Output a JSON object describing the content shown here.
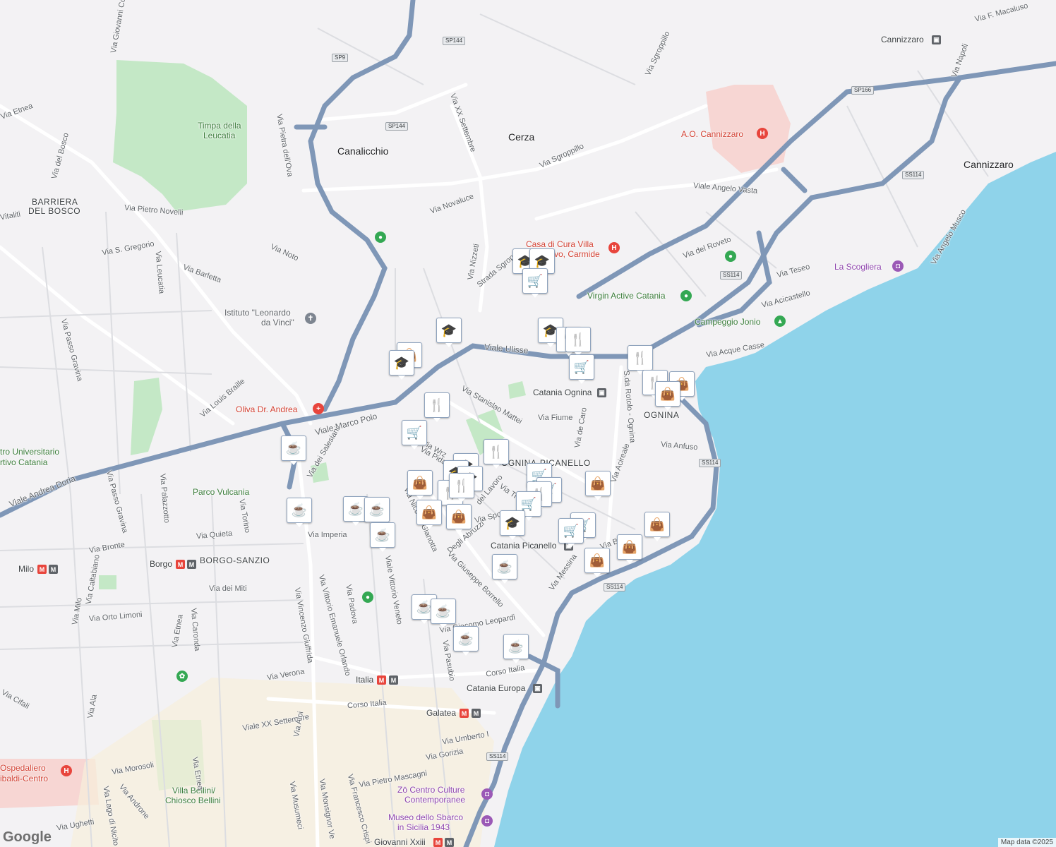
{
  "colors": {
    "background": "#f3f2f4",
    "sea": "#8fd3ea",
    "park": "#c4e8c6",
    "hospital": "#f3c1bd",
    "highway": "#7f97b7",
    "major_road": "#ffffff",
    "marker_icon": "#1a3458"
  },
  "labels": {
    "canalicchio": "Canalicchio",
    "cerza": "Cerza",
    "cannizzaro1": "Cannizzaro",
    "cannizzaro2": "Cannizzaro",
    "barriera1": "BARRIERA",
    "barriera2": "DEL BOSCO",
    "timpa1": "Timpa della",
    "timpa2": "Leucatia",
    "ognina": "OGNINA",
    "ognina_picanello": "OGNINA-PICANELLO",
    "borgo_sanzio": "BORGO-SANZIO",
    "parco_vulcania": "Parco Vulcania",
    "centro_univ1": "tro Universitario",
    "centro_univ2": "rtivo Catania",
    "istituto1": "Istituto \"Leonardo",
    "istituto2": "da Vinci\"",
    "oliva": "Oliva Dr. Andrea",
    "casa_cura1": "Casa di Cura Villa",
    "casa_cura2": "vo, Carmide",
    "ao_cannizzaro": "A.O. Cannizzaro",
    "virgin": "Virgin Active Catania",
    "scogliera": "La Scogliera",
    "campeggio": "Campeggio Jonio",
    "catania_ognina": "Catania Ognina",
    "catania_picanello": "Catania Picanello",
    "catania_europa": "Catania Europa",
    "ospedaliero1": "Ospedaliero",
    "ospedaliero2": "ibaldi-Centro",
    "villa_bellini1": "Villa Bellini/",
    "villa_bellini2": "Chiosco Bellini",
    "zo1": "Zō Centro Culture",
    "zo2": "Contemporanee",
    "museo1": "Museo dello Sbarco",
    "museo2": "in Sicilia 1943",
    "milo": "Milo",
    "borgo": "Borgo",
    "italia": "Italia",
    "galatea": "Galatea",
    "giovanni": "Giovanni Xxiii",
    "via_etnea_top": "Via Etnea",
    "via_del_bosco": "Via del Bosco",
    "via_giovanni": "Via Giovanni Co",
    "via_pietra": "Via Pietra dell'Ova",
    "via_xx_settembre_top": "Via XX Settembre",
    "via_sgroppillo1": "Via Sgroppillo",
    "via_sgroppillo2": "Via Sgroppillo",
    "via_novaluce": "Via Novaluce",
    "via_nizzeti": "Via Nizzeti",
    "strada_sgrop": "Strada Sgrop",
    "via_pietro_novelli": "Via Pietro Novelli",
    "via_vitaliti": "Vitaliti",
    "via_s_gregorio": "Via S. Gregorio",
    "via_noto": "Via Noto",
    "via_barletta": "Via Barletta",
    "via_leucatia": "Via Leucatia",
    "via_passo_gravina1": "Via Passo Gravina",
    "via_passo_gravina2": "Via Passo Gravina",
    "via_louis_braille": "Via Louis Braille",
    "viale_marco_polo": "Viale Marco Polo",
    "viale_andrea_doria": "Viale Andrea Doria",
    "viale_ulisse": "Viale Ulisse",
    "via_stanislao": "Via Stanislao Mattei",
    "via_fiume": "Via Fiume",
    "via_de_caro": "Via de Caro",
    "via_rotolo": "S.da Rotolo - Ognina",
    "via_acireale": "Via Acireale",
    "via_anfuso": "Via Anfuso",
    "via_del_roveto": "Via del Roveto",
    "viale_angelo_vasta": "Viale Angelo Vasta",
    "via_teseo": "Via Teseo",
    "via_acicastello": "Via Acicastello",
    "via_acque_casse": "Via Acque Casse",
    "via_angelo_musco": "Via Angelo Musco",
    "via_napoli": "Via Napoli",
    "via_f_macaluso": "Via F. Macaluso",
    "via_dei_salesiani": "Via dei Salesiani",
    "via_palazzotto": "Via Palazzotto",
    "via_torino": "Via Torino",
    "via_quieta": "Via Quieta",
    "via_imperia": "Via Imperia",
    "via_bronte": "Via Bronte",
    "via_caltabiano": "Via Caltabiano",
    "via_milo": "Via Milo",
    "via_orto_limoni": "Via Orto Limoni",
    "via_dei_miti": "Via dei Miti",
    "via_etnea": "Via Etnea",
    "via_caronda": "Via Caronda",
    "via_nicolo": "Via Niccolò Gianotta",
    "via_abruzzi": "Degli Abruzzi",
    "via_giuseppe_borrello": "Via Giuseppe Borrello",
    "via_spoto": "Via Spoto",
    "via_messina": "Via Messina",
    "via_leopardi": "Via Giacomo Leopardi",
    "via_padova": "Via Padova",
    "viale_vittorio_veneto": "Viale Vittorio Veneto",
    "via_vincenzo": "Via Vincenzo Giuffrida",
    "viale_vittorio_em": "Via Vittorio Emanuele Orlando",
    "via_pasubio": "Via Pasubio",
    "via_verona": "Via Verona",
    "corso_italia1": "Corso Italia",
    "corso_italia2": "Corso Italia",
    "viale_xx_settembre": "Viale XX Settembre",
    "via_aloi": "Via Aloi",
    "via_umberto": "Via Umberto I",
    "via_gorizia": "Via Gorizia",
    "via_pietro_mascagni": "Via Pietro Mascagni",
    "via_morosoli": "Via Morosoli",
    "via_androne": "Via Androne",
    "via_lago_di_nicito": "Via Lago di Nicito",
    "via_ughetti": "Via Ughetti",
    "via_musumeci": "Via Musumeci",
    "via_monsignor": "Via Monsignor Ve",
    "via_francesco_crispi": "Via Francesco Crispi",
    "via_etnea_bottom": "Via Etnea",
    "via_cifali": "Via Cifali",
    "via_ala": "Via Ala",
    "via_vecchia": "Via Pidatella",
    "via_del_lavoro": "del Lavoro",
    "via_b": "Via B",
    "via_wrz": "Via Wrz",
    "via_lume": "Via Ti"
  },
  "shields": [
    "SP9",
    "SP144",
    "SP144",
    "SP166",
    "SS114",
    "SS114",
    "SS114",
    "SS114",
    "SS114"
  ],
  "attribution": "Map data ©2025",
  "logo": "Google"
}
